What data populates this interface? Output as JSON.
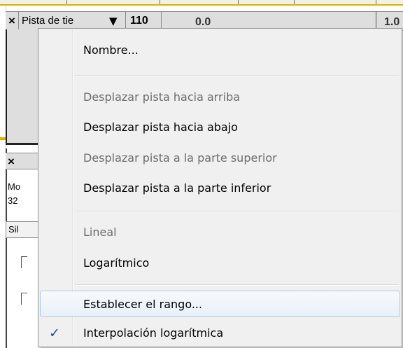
{
  "track_header": {
    "close_label": "×",
    "track_name": "Pista de tie",
    "dropdown_arrow": "▼",
    "value": "110",
    "ruler_start": "0.0",
    "ruler_next": "1.0"
  },
  "track2": {
    "close_label": "×",
    "mode_text": "Mo",
    "rate_text": "32",
    "mute_text": "Sil"
  },
  "context_menu": {
    "items": [
      {
        "label": "Nombre...",
        "enabled": true
      },
      {
        "label": "Desplazar pista hacia arriba",
        "enabled": false
      },
      {
        "label": "Desplazar pista hacia abajo",
        "enabled": true
      },
      {
        "label": "Desplazar pista a la parte superior",
        "enabled": false
      },
      {
        "label": "Desplazar pista a la parte inferior",
        "enabled": true
      },
      {
        "label": "Lineal",
        "enabled": false
      },
      {
        "label": "Logarítmico",
        "enabled": true
      },
      {
        "label": "Establecer el rango...",
        "enabled": true,
        "highlighted": true
      },
      {
        "label": "Interpolación logarítmica",
        "enabled": true,
        "checked": true
      }
    ],
    "check_mark": "✓"
  },
  "colors": {
    "menu_background": "#f0f0f0",
    "highlight_border": "#aac8e8",
    "accent_gold": "#d8b300",
    "check_mark": "#1c4e9c"
  }
}
